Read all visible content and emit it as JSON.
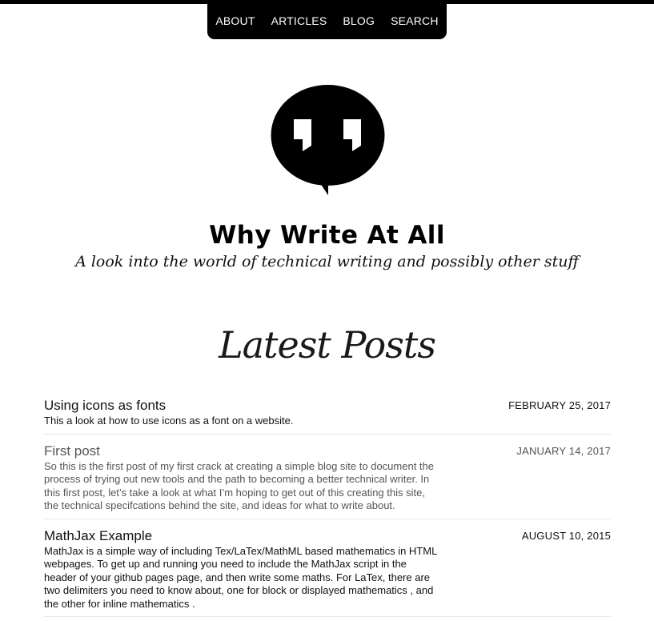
{
  "nav": {
    "items": [
      {
        "label": "ABOUT"
      },
      {
        "label": "ARTICLES"
      },
      {
        "label": "BLOG"
      },
      {
        "label": "SEARCH"
      }
    ]
  },
  "logo": {
    "icon": "quote-bubble-icon"
  },
  "site": {
    "title": "Why Write At All",
    "tagline": "A look into the world of technical writing and possibly other stuff"
  },
  "latest": {
    "heading": "Latest Posts",
    "posts": [
      {
        "title": "Using icons as fonts",
        "date": "FEBRUARY 25, 2017",
        "excerpt": "This a look at how to use icons as a font on a website."
      },
      {
        "title": "First post",
        "date": "JANUARY 14, 2017",
        "excerpt": "So this is the first post of my first crack at creating a simple blog site to document the process of trying out new tools and the path to becoming a better technical writer. In this first post, let’s take a look at what I’m hoping to get out of this creating this site, the technical specifcations behind the site, and ideas for what to write about."
      },
      {
        "title": "MathJax Example",
        "date": "AUGUST 10, 2015",
        "excerpt": "MathJax is a simple way of including Tex/LaTex/MathML based mathematics in HTML webpages. To get up and running you need to include the MathJax script in the header of your github pages page, and then write some maths. For LaTex, there are two delimiters you need to know about, one for block or displayed mathematics , and the other for inline mathematics ."
      }
    ]
  }
}
